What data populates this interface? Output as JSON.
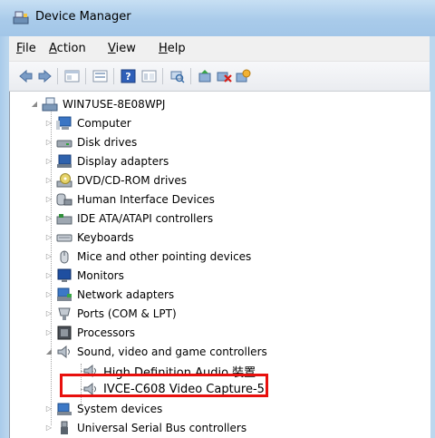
{
  "window": {
    "title": "Device Manager"
  },
  "menu": [
    {
      "key": "F",
      "rest": "ile"
    },
    {
      "key": "A",
      "rest": "ction"
    },
    {
      "key": "V",
      "rest": "iew"
    },
    {
      "key": "H",
      "rest": "elp"
    }
  ],
  "toolbar_icons": [
    "back-icon",
    "forward-icon",
    "properties-pane-icon",
    "console-tree-icon",
    "help-icon",
    "show-hide-icon",
    "scan-hardware-icon",
    "update-driver-icon",
    "uninstall-icon",
    "enable-device-icon"
  ],
  "tree": {
    "root": "WIN7USE-8E08WPJ",
    "categories": [
      {
        "label": "Computer",
        "icon": "computer-icon"
      },
      {
        "label": "Disk drives",
        "icon": "disk-drive-icon"
      },
      {
        "label": "Display adapters",
        "icon": "display-adapter-icon"
      },
      {
        "label": "DVD/CD-ROM drives",
        "icon": "dvd-drive-icon"
      },
      {
        "label": "Human Interface Devices",
        "icon": "hid-icon"
      },
      {
        "label": "IDE ATA/ATAPI controllers",
        "icon": "ide-controller-icon"
      },
      {
        "label": "Keyboards",
        "icon": "keyboard-icon"
      },
      {
        "label": "Mice and other pointing devices",
        "icon": "mouse-icon"
      },
      {
        "label": "Monitors",
        "icon": "monitor-icon"
      },
      {
        "label": "Network adapters",
        "icon": "network-adapter-icon"
      },
      {
        "label": "Ports (COM & LPT)",
        "icon": "port-icon"
      },
      {
        "label": "Processors",
        "icon": "processor-icon"
      },
      {
        "label": "Sound, video and game controllers",
        "icon": "speaker-icon"
      },
      {
        "label": "System devices",
        "icon": "system-device-icon"
      },
      {
        "label": "Universal Serial Bus controllers",
        "icon": "usb-icon"
      }
    ],
    "sound_children": [
      {
        "label": "High Definition Audio 裝置",
        "icon": "speaker-icon"
      },
      {
        "label": "IVCE-C608 Video Capture-5",
        "icon": "speaker-icon"
      }
    ]
  },
  "colors": {
    "highlight_border": "#e8100d",
    "titlebar": "#a9cbea"
  }
}
